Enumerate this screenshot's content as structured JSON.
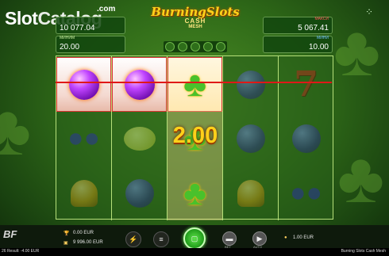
{
  "watermark": {
    "brand_slot": "Slot",
    "brand_catalog": "Catalog",
    "tld": ".com"
  },
  "logo": {
    "line1": "BurningSlots",
    "line2": "CASH",
    "line3": "MESH"
  },
  "panels": {
    "total_win": {
      "label": "",
      "value": "10 077.04"
    },
    "min_bet": {
      "label": "МИНИМ",
      "value": "20.00"
    },
    "jackpot_max": {
      "label": "МАКСИ",
      "value": "5 067.41"
    },
    "jackpot_mini": {
      "label": "МИНИ",
      "value": "10.00"
    }
  },
  "reels": [
    [
      "plum-hi",
      "grapes",
      "bell"
    ],
    [
      "plum-hi",
      "lemon",
      "plumdark"
    ],
    [
      "clover-hi",
      "clover",
      "clover"
    ],
    [
      "plumdark",
      "plumdark",
      "bell"
    ],
    [
      "seven",
      "plumdark",
      "grapes"
    ]
  ],
  "win_amount": "2.00",
  "bottom": {
    "brand": "BF",
    "win_value": "0.00 EUR",
    "balance_value": "9 996.00 EUR",
    "bet_value": "1.00 EUR",
    "bet_label": "BET",
    "auto_label": "AUTO"
  },
  "status": {
    "left": "26 Result: -4.00 EUR",
    "right": "Burning Slots Cash Mesh"
  },
  "colors": {
    "reel_border": "#b6e07a",
    "win_line": "#e01818",
    "win_text": "#ffd01a",
    "spin_button": "#209a1a"
  }
}
